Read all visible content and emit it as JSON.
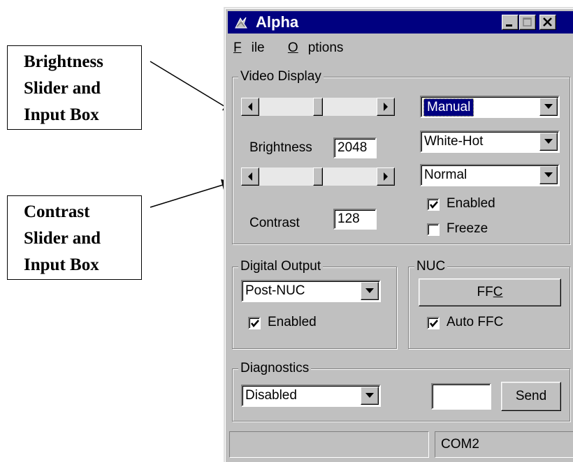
{
  "callouts": {
    "brightness": [
      "Brightness",
      "Slider and",
      "Input Box"
    ],
    "contrast": [
      "Contrast",
      "Slider and",
      "Input Box"
    ]
  },
  "window": {
    "title": "Alpha",
    "menu": {
      "file": "File",
      "options": "Options"
    }
  },
  "video_display": {
    "label": "Video Display",
    "brightness_label": "Brightness",
    "brightness_value": "2048",
    "brightness_slider_level": 0.5,
    "contrast_label": "Contrast",
    "contrast_value": "128",
    "contrast_slider_level": 0.5,
    "mode_select": "Manual",
    "polarity_select": "White-Hot",
    "orientation_select": "Normal",
    "enabled_label": "Enabled",
    "enabled_checked": true,
    "freeze_label": "Freeze",
    "freeze_checked": false
  },
  "digital_output": {
    "label": "Digital Output",
    "select": "Post-NUC",
    "enabled_label": "Enabled",
    "enabled_checked": true
  },
  "nuc": {
    "label": "NUC",
    "ffc_button_prefix": "FF",
    "ffc_button_accel": "C",
    "auto_ffc_label": "Auto FFC",
    "auto_ffc_checked": true
  },
  "diagnostics": {
    "label": "Diagnostics",
    "select": "Disabled",
    "input_value": "",
    "send_label": "Send"
  },
  "status": {
    "pane1": "",
    "pane2": "COM2"
  }
}
